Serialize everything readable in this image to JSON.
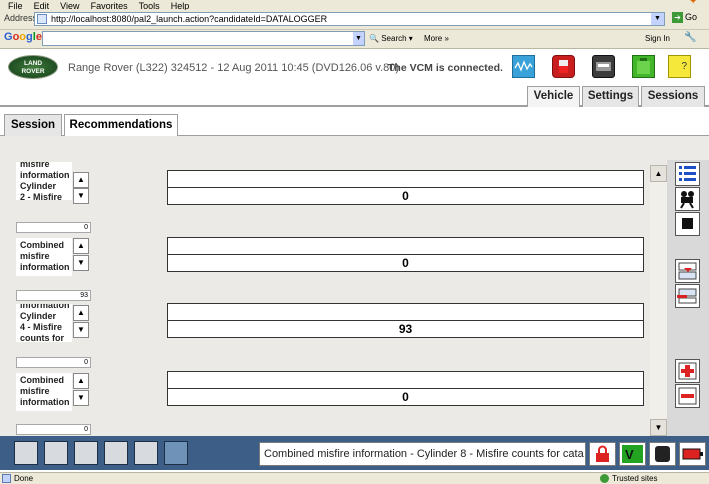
{
  "browser": {
    "menu": [
      "File",
      "Edit",
      "View",
      "Favorites",
      "Tools",
      "Help"
    ],
    "address_label": "Address",
    "url": "http://localhost:8080/pal2_launch.action?candidateId=DATALOGGER",
    "go_label": "Go",
    "google_logo": [
      "G",
      "o",
      "o",
      "g",
      "l",
      "e"
    ],
    "search_label": "Search",
    "more_label": "More »",
    "signin_label": "Sign In",
    "status_left": "Done",
    "status_right": "Trusted sites"
  },
  "app": {
    "logo_text": [
      "LAND",
      "ROVER"
    ],
    "vehicle_info": "Range Rover (L322) 324512 - 12 Aug 2011 10:45 (DVD126.06 v.80)",
    "vcm_status": "The VCM is connected.",
    "header_icons": [
      "oscilloscope-icon",
      "fuel-flask-icon",
      "vcm-module-icon",
      "battery-icon",
      "help-icon"
    ],
    "help_glyph": "?",
    "vehicle_tabs": [
      "Vehicle",
      "Settings",
      "Sessions"
    ],
    "session_tabs": [
      "Session",
      "Recommendations"
    ],
    "active_vehicle_tab": "Vehicle",
    "active_session_tab": "Recommendations"
  },
  "rows": [
    {
      "input_value": "",
      "label_lines": [
        "misfire",
        "information",
        "Cylinder",
        "2  -  Misfire"
      ],
      "display_value": "0"
    },
    {
      "input_value": "0",
      "label_lines": [
        "Combined",
        "misfire",
        "information"
      ],
      "display_value": "0"
    },
    {
      "input_value": "93",
      "label_lines": [
        "information",
        "Cylinder",
        "4  -  Misfire",
        "counts for"
      ],
      "display_value": "93"
    },
    {
      "input_value": "0",
      "label_lines": [
        "Combined",
        "misfire",
        "information"
      ],
      "display_value": "0"
    },
    {
      "input_value": "0"
    }
  ],
  "spin": {
    "up": "▲",
    "down": "▼"
  },
  "bottom": {
    "message": "Combined misfire information  -  Cylinder 8  -  Misfire counts for cata"
  },
  "colors": {
    "taskbar": "#3d5f87",
    "content_bg": "#eceae6",
    "tab_border": "#9f9f9f"
  }
}
